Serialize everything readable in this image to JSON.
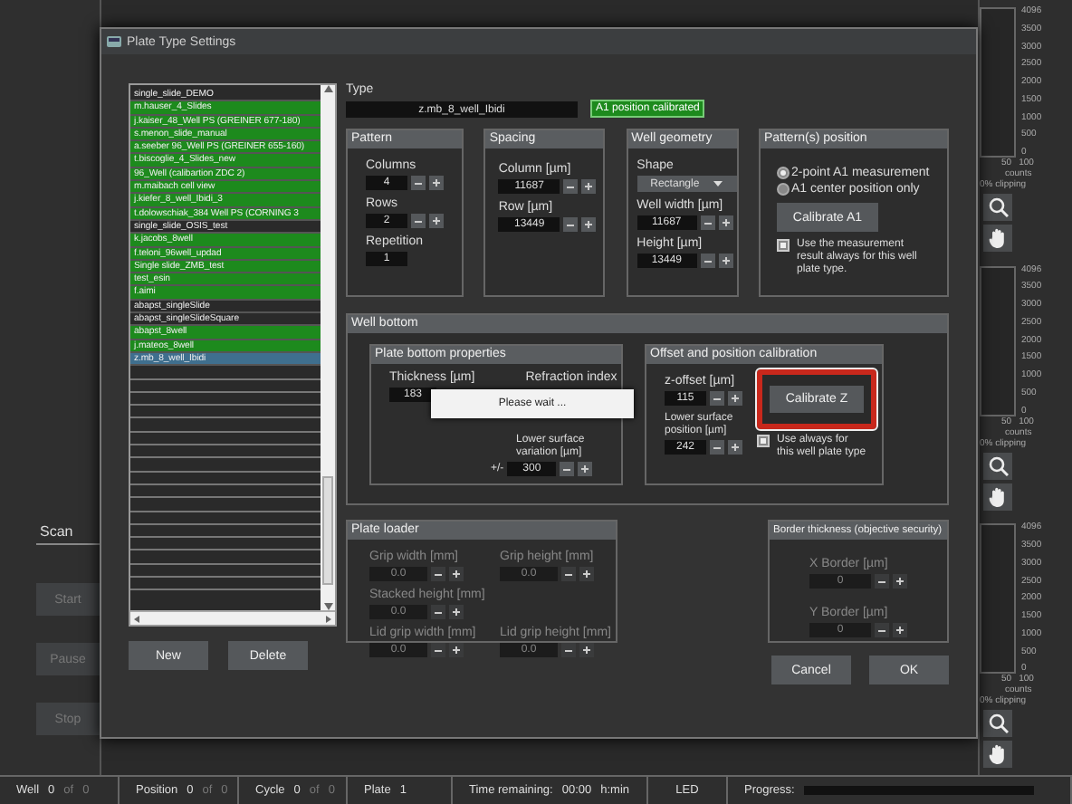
{
  "window": {
    "title": "Plate Type Settings"
  },
  "background": {
    "tab": "Scan",
    "buttons": [
      {
        "label": "Start",
        "disabled": true
      },
      {
        "label": "Pause",
        "disabled": true
      },
      {
        "label": "Stop",
        "disabled": true
      }
    ],
    "histograms": [
      {
        "ticks": [
          "4096",
          "3500",
          "3000",
          "2500",
          "2000",
          "1500",
          "1000",
          "500",
          "0"
        ],
        "x_ticks": [
          "50",
          "100"
        ],
        "x_label": "counts",
        "clipping": "0% clipping"
      },
      {
        "ticks": [
          "4096",
          "3500",
          "3000",
          "2500",
          "2000",
          "1500",
          "1000",
          "500",
          "0"
        ],
        "x_ticks": [
          "50",
          "100"
        ],
        "x_label": "counts",
        "clipping": "0% clipping"
      },
      {
        "ticks": [
          "4096",
          "3500",
          "3000",
          "2500",
          "2000",
          "1500",
          "1000",
          "500",
          "0"
        ],
        "x_ticks": [
          "50",
          "100"
        ],
        "x_label": "counts",
        "clipping": "0% clipping"
      }
    ]
  },
  "plate_types": [
    {
      "label": "single_slide_DEMO",
      "calibrated": false,
      "selected": false
    },
    {
      "label": "m.hauser_4_Slides",
      "calibrated": true,
      "selected": false
    },
    {
      "label": "j.kaiser_48_Well PS (GREINER 677-180)",
      "calibrated": true,
      "selected": false
    },
    {
      "label": "s.menon_slide_manual",
      "calibrated": true,
      "selected": false
    },
    {
      "label": "a.seeber 96_Well PS (GREINER 655-160)",
      "calibrated": true,
      "selected": false
    },
    {
      "label": "t.biscoglie_4_Slides_new",
      "calibrated": true,
      "selected": false
    },
    {
      "label": "96_Well (calibartion ZDC 2)",
      "calibrated": true,
      "selected": false
    },
    {
      "label": "m.maibach cell view",
      "calibrated": true,
      "selected": false
    },
    {
      "label": "j.kiefer_8_well_Ibidi_3",
      "calibrated": true,
      "selected": false
    },
    {
      "label": "t.dolowschiak_384 Well PS (CORNING 3",
      "calibrated": true,
      "selected": false
    },
    {
      "label": "single_slide_OSIS_test",
      "calibrated": false,
      "selected": false
    },
    {
      "label": "k.jacobs_8well",
      "calibrated": true,
      "selected": false
    },
    {
      "label": "f.teloni_96well_updad",
      "calibrated": true,
      "selected": false
    },
    {
      "label": "Single slide_ZMB_test",
      "calibrated": true,
      "selected": false
    },
    {
      "label": "test_esin",
      "calibrated": true,
      "selected": false
    },
    {
      "label": "f.aimi",
      "calibrated": true,
      "selected": false
    },
    {
      "label": "abapst_singleSlide",
      "calibrated": false,
      "selected": false
    },
    {
      "label": "abapst_singleSlideSquare",
      "calibrated": false,
      "selected": false
    },
    {
      "label": "abapst_8well",
      "calibrated": true,
      "selected": false
    },
    {
      "label": "j.mateos_8well",
      "calibrated": true,
      "selected": false
    },
    {
      "label": "z.mb_8_well_Ibidi",
      "calibrated": false,
      "selected": true
    }
  ],
  "list_buttons": [
    "New",
    "Delete"
  ],
  "type": {
    "label": "Type",
    "value": "z.mb_8_well_Ibidi",
    "badge": "A1 position calibrated"
  },
  "pattern": {
    "title": "Pattern",
    "fields": [
      {
        "label": "Columns",
        "value": "4",
        "stepper": true
      },
      {
        "label": "Rows",
        "value": "2",
        "stepper": true
      },
      {
        "label": "Repetition",
        "value": "1",
        "stepper": false
      }
    ]
  },
  "spacing": {
    "title": "Spacing",
    "fields": [
      {
        "label": "Column [µm]",
        "value": "11687",
        "stepper": true
      },
      {
        "label": "Row [µm]",
        "value": "13449",
        "stepper": true
      }
    ]
  },
  "well_geometry": {
    "title": "Well geometry",
    "shape_label": "Shape",
    "shape": "Rectangle",
    "fields": [
      {
        "label": "Well width [µm]",
        "value": "11687",
        "stepper": true
      },
      {
        "label": "Height [µm]",
        "value": "13449",
        "stepper": true
      }
    ]
  },
  "patterns_position": {
    "title": "Pattern(s) position",
    "options": [
      {
        "label": "2-point A1 measurement",
        "selected": true
      },
      {
        "label": "A1 center position only",
        "selected": false
      }
    ],
    "button": "Calibrate A1",
    "checkbox": {
      "label": "Use the measurement result always for this well plate type.",
      "checked": true
    }
  },
  "well_bottom": {
    "title": "Well bottom",
    "plate_bottom": {
      "title": "Plate bottom properties",
      "thickness": {
        "label": "Thickness [µm]",
        "value": "183"
      },
      "refraction_label": "Refraction index",
      "variation": {
        "label": "Lower surface variation [µm]",
        "prefix": "+/-",
        "value": "300"
      }
    },
    "offset": {
      "title": "Offset and position calibration",
      "fields": [
        {
          "label": "z-offset [µm]",
          "value": "115"
        },
        {
          "label": "Lower surface position [µm]",
          "value": "242"
        }
      ],
      "button": "Calibrate Z",
      "highlighted": true,
      "checkbox": {
        "label": "Use always for this well plate type",
        "checked": true
      }
    }
  },
  "popup": {
    "text": "Please wait ..."
  },
  "plate_loader": {
    "title": "Plate loader",
    "disabled": true,
    "rows": [
      [
        {
          "label": "Grip width [mm]",
          "value": "0.0"
        },
        {
          "label": "Grip height [mm]",
          "value": "0.0"
        }
      ],
      [
        {
          "label": "Stacked height [mm]",
          "value": "0.0"
        }
      ],
      [
        {
          "label": "Lid grip width [mm]",
          "value": "0.0"
        },
        {
          "label": "Lid grip height [mm]",
          "value": "0.0"
        }
      ]
    ]
  },
  "border_thickness": {
    "title": "Border thickness (objective security)",
    "disabled": true,
    "fields": [
      {
        "label": "X Border [µm]",
        "value": "0"
      },
      {
        "label": "Y Border [µm]",
        "value": "0"
      }
    ]
  },
  "dialog_buttons": [
    "Cancel",
    "OK"
  ],
  "status_bar": [
    {
      "kind": "counter",
      "label": "Well",
      "value": "0",
      "of": "of",
      "total": "0"
    },
    {
      "kind": "counter",
      "label": "Position",
      "value": "0",
      "of": "of",
      "total": "0"
    },
    {
      "kind": "counter",
      "label": "Cycle",
      "value": "0",
      "of": "of",
      "total": "0"
    },
    {
      "kind": "value",
      "label": "Plate",
      "value": "1"
    },
    {
      "kind": "time",
      "label": "Time remaining:",
      "value": "00:00",
      "unit": "h:min"
    },
    {
      "kind": "label",
      "label": "LED"
    },
    {
      "kind": "progress",
      "label": "Progress:",
      "level": 0
    }
  ]
}
